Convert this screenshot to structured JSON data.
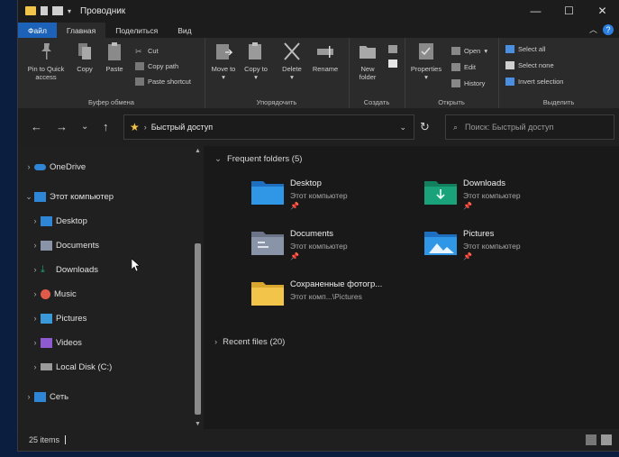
{
  "window": {
    "title": "Проводник"
  },
  "tabs": {
    "file": "Файл",
    "home": "Главная",
    "share": "Поделиться",
    "view": "Вид"
  },
  "ribbon": {
    "clipboard": {
      "label": "Буфер обмена",
      "pin": "Pin to Quick access",
      "copy": "Copy",
      "paste": "Paste",
      "cut": "Cut",
      "copy_path": "Copy path",
      "paste_shortcut": "Paste shortcut"
    },
    "organize": {
      "label": "Упорядочить",
      "move_to": "Move to",
      "copy_to": "Copy to",
      "delete": "Delete",
      "rename": "Rename"
    },
    "create": {
      "label": "Создать",
      "new_folder": "New folder"
    },
    "open": {
      "label": "Открыть",
      "properties": "Properties",
      "open": "Open",
      "edit": "Edit",
      "history": "History"
    },
    "select": {
      "label": "Выделить",
      "select_all": "Select all",
      "select_none": "Select none",
      "invert": "Invert selection"
    }
  },
  "nav": {
    "location": "Быстрый доступ",
    "search_placeholder": "Поиск: Быстрый доступ"
  },
  "sidebar": {
    "items": [
      {
        "label": "OneDrive",
        "icon": "cloud-icon"
      },
      {
        "label": "Этот компьютер",
        "icon": "computer-icon"
      },
      {
        "label": "Desktop",
        "icon": "desktop-icon"
      },
      {
        "label": "Documents",
        "icon": "documents-icon"
      },
      {
        "label": "Downloads",
        "icon": "downloads-icon"
      },
      {
        "label": "Music",
        "icon": "music-icon"
      },
      {
        "label": "Pictures",
        "icon": "pictures-icon"
      },
      {
        "label": "Videos",
        "icon": "videos-icon"
      },
      {
        "label": "Local Disk (C:)",
        "icon": "disk-icon"
      },
      {
        "label": "Сеть",
        "icon": "network-icon"
      }
    ]
  },
  "main": {
    "frequent_header": "Frequent folders (5)",
    "recent_header": "Recent files (20)",
    "folders": [
      {
        "name": "Desktop",
        "sub": "Этот компьютер",
        "pinned": true
      },
      {
        "name": "Downloads",
        "sub": "Этот компьютер",
        "pinned": true
      },
      {
        "name": "Documents",
        "sub": "Этот компьютер",
        "pinned": true
      },
      {
        "name": "Pictures",
        "sub": "Этот компьютер",
        "pinned": true
      },
      {
        "name": "Сохраненные фотогр...",
        "sub": "Этот комп...\\Pictures",
        "pinned": false
      }
    ]
  },
  "status": {
    "count": "25 items"
  },
  "colors": {
    "accent": "#1b62b8",
    "folder_yellow": "#f2c44a",
    "folder_blue": "#2f86d6",
    "folder_green": "#1aa37a"
  }
}
